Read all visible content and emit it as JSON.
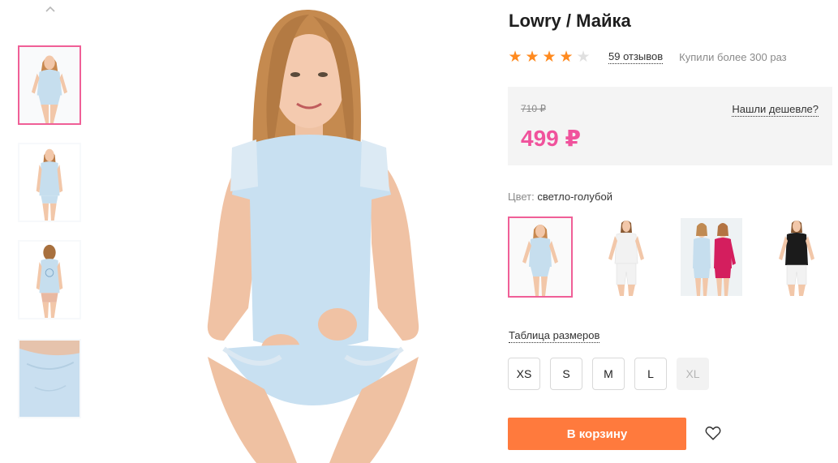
{
  "thumbnails": {
    "up_arrow": "chevron-up-icon",
    "items": [
      {
        "name": "thumb-front",
        "active": true
      },
      {
        "name": "thumb-front-2",
        "active": false
      },
      {
        "name": "thumb-back",
        "active": false
      },
      {
        "name": "thumb-fabric-closeup",
        "active": false
      }
    ]
  },
  "product": {
    "title": "Lowry / Майка",
    "rating": 4,
    "rating_max": 5,
    "reviews_label": "59 отзывов",
    "bought_label": "Купили более 300 раз"
  },
  "price": {
    "old": "710 ₽",
    "new": "499 ₽",
    "cheaper_link": "Нашли дешевле?"
  },
  "color": {
    "label": "Цвет:",
    "value": "светло-голубой",
    "options": [
      {
        "name": "swatch-light-blue",
        "active": true
      },
      {
        "name": "swatch-white",
        "active": false
      },
      {
        "name": "swatch-two-models",
        "active": false
      },
      {
        "name": "swatch-black",
        "active": false
      }
    ]
  },
  "sizes": {
    "table_link": "Таблица размеров",
    "options": [
      {
        "label": "XS",
        "available": true
      },
      {
        "label": "S",
        "available": true
      },
      {
        "label": "M",
        "available": true
      },
      {
        "label": "L",
        "available": true
      },
      {
        "label": "XL",
        "available": false
      }
    ]
  },
  "actions": {
    "add_to_cart": "В корзину",
    "favorite_icon": "heart-icon"
  },
  "colors": {
    "accent_pink": "#f05f97",
    "price_pink": "#f0529c",
    "cart_orange": "#ff7a3d",
    "star_orange": "#ff8a1f",
    "star_gray": "#e0e0e0"
  }
}
